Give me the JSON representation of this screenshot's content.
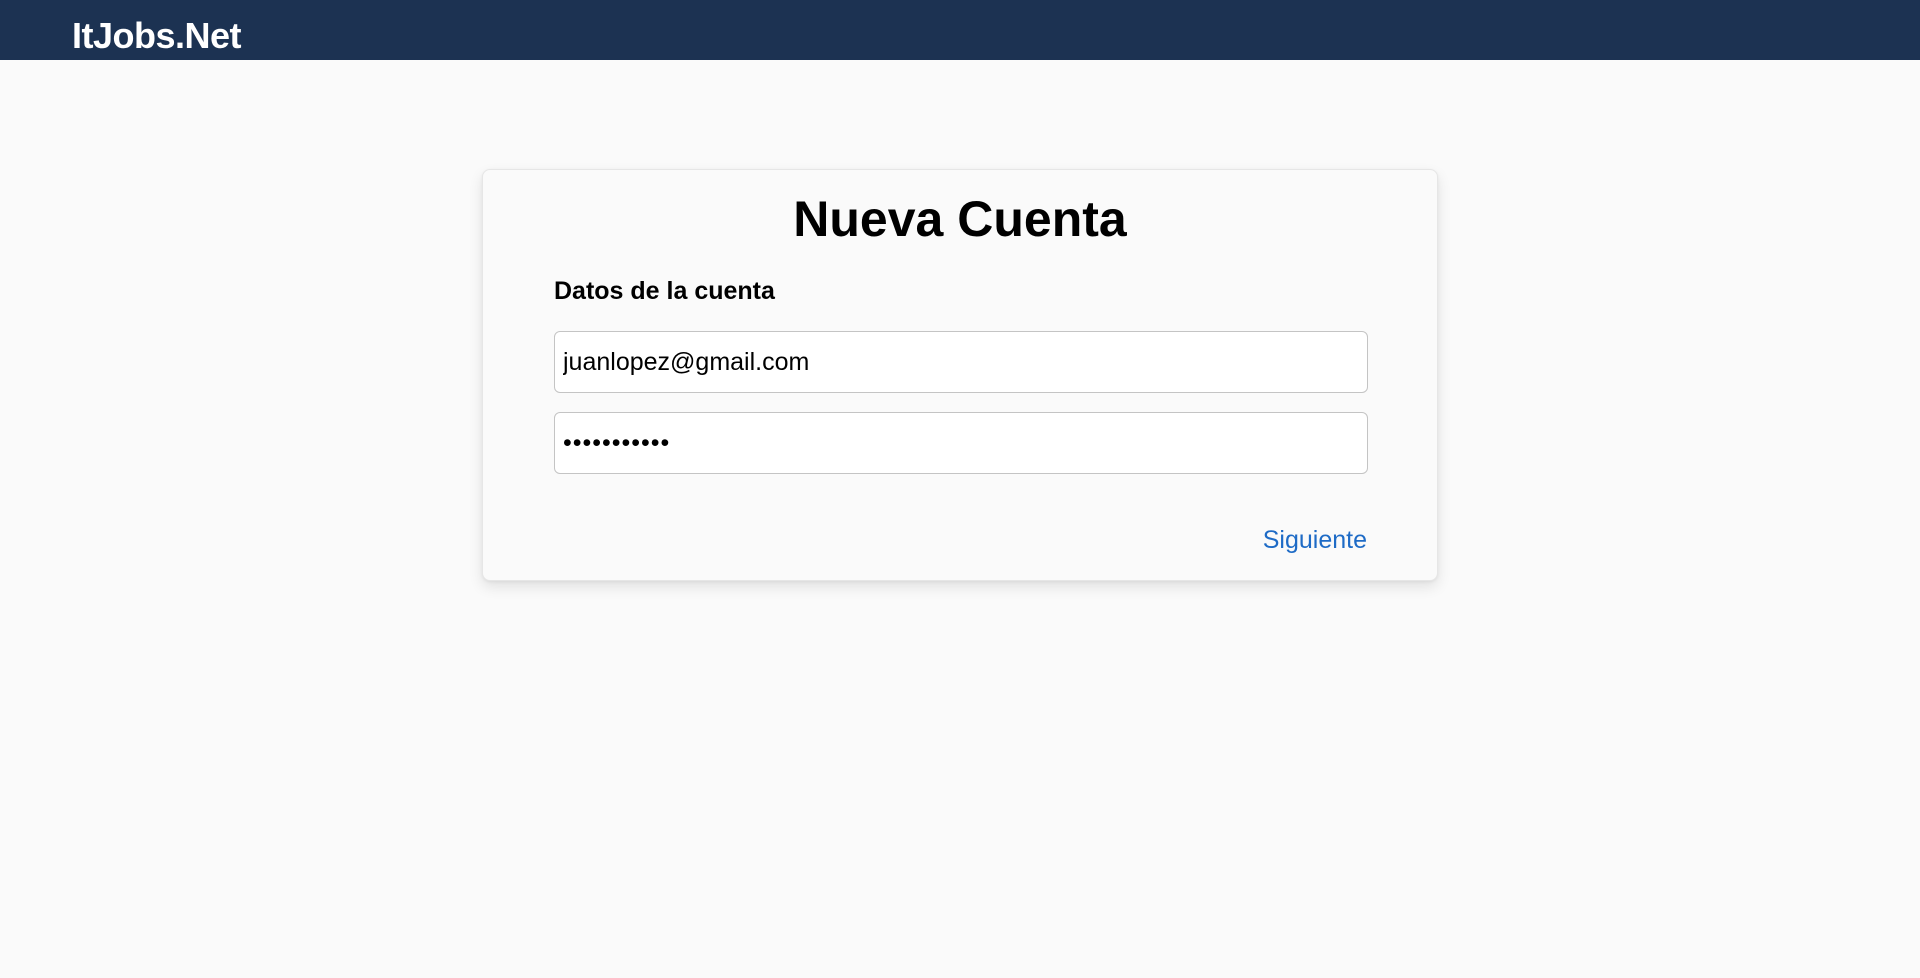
{
  "header": {
    "brand": "ItJobs.Net",
    "background_color": "#1c3252"
  },
  "card": {
    "title": "Nueva Cuenta",
    "section_label": "Datos de la cuenta",
    "email_value": "juanlopez@gmail.com",
    "password_value": "contrasena1",
    "next_label": "Siguiente",
    "link_color": "#1e6bc6"
  }
}
